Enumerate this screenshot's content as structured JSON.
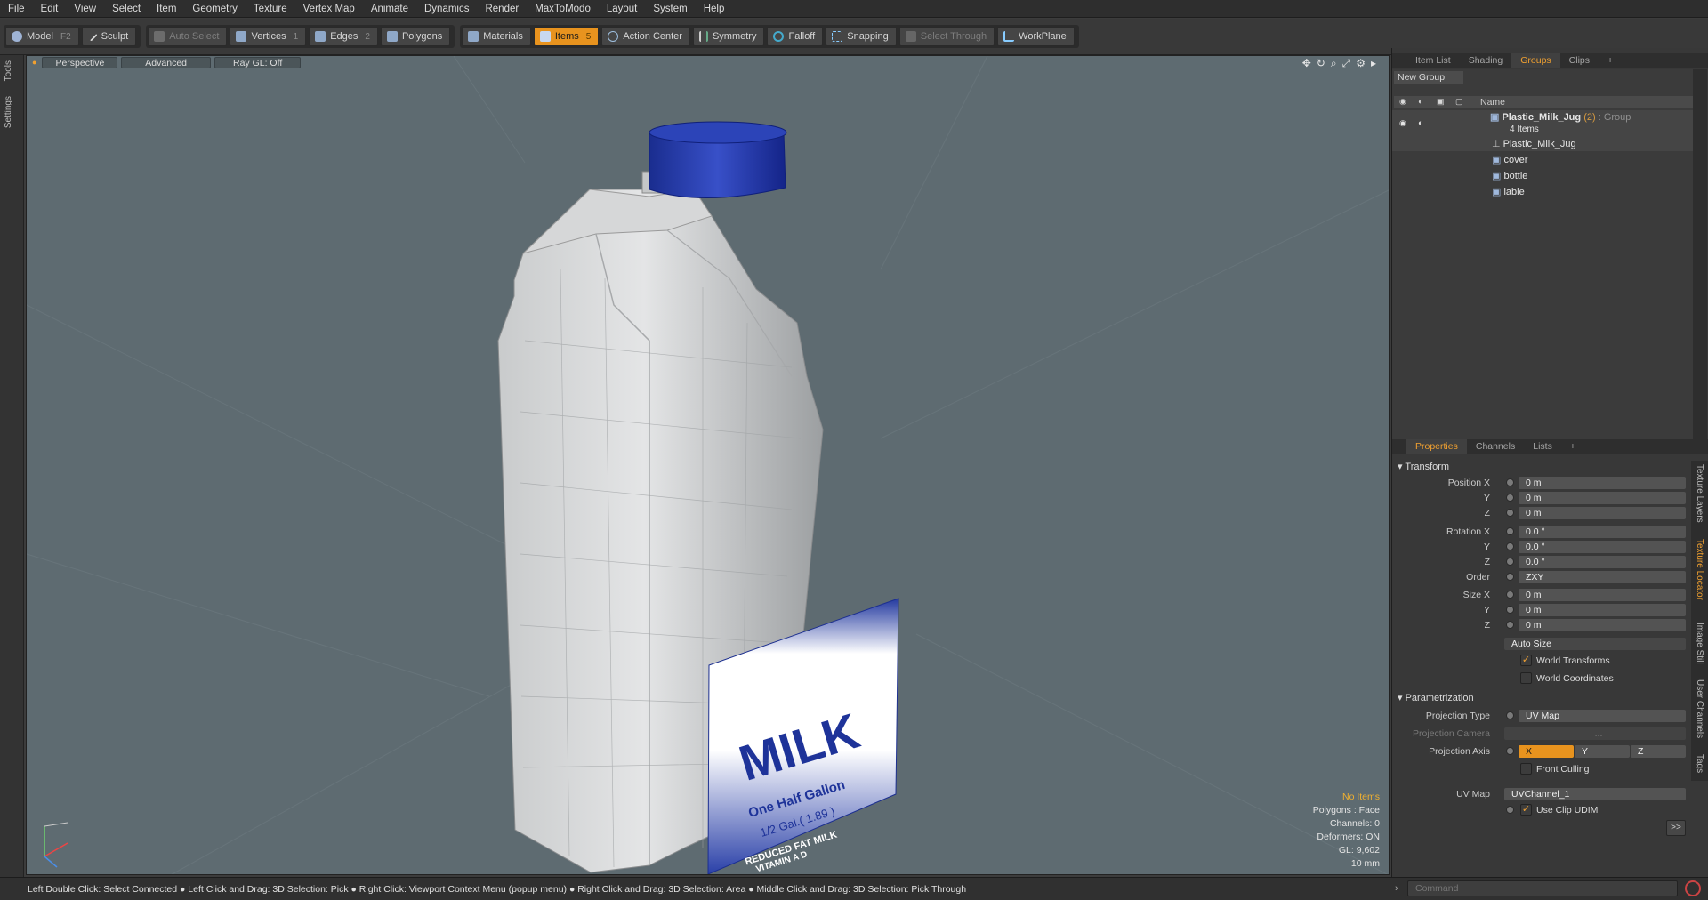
{
  "menu": [
    "File",
    "Edit",
    "View",
    "Select",
    "Item",
    "Geometry",
    "Texture",
    "Vertex Map",
    "Animate",
    "Dynamics",
    "Render",
    "MaxToModo",
    "Layout",
    "System",
    "Help"
  ],
  "toolbar": {
    "model": "Model",
    "model_key": "F2",
    "sculpt": "Sculpt",
    "auto_select": "Auto Select",
    "vertices": "Vertices",
    "vertices_key": "1",
    "edges": "Edges",
    "edges_key": "2",
    "polygons": "Polygons",
    "materials": "Materials",
    "items": "Items",
    "items_key": "5",
    "action_center": "Action Center",
    "symmetry": "Symmetry",
    "falloff": "Falloff",
    "snapping": "Snapping",
    "select_through": "Select Through",
    "workplane": "WorkPlane"
  },
  "left_tabs": [
    "Tools",
    "Settings"
  ],
  "viewport": {
    "perspective": "Perspective",
    "advanced": "Advanced",
    "raygl": "Ray GL: Off",
    "label": {
      "title": "MILK",
      "line1": "One Half Gallon",
      "line2": "1/2 Gal.( 1.89 )",
      "line3": "REDUCED FAT MILK",
      "line4": "VITAMIN A D"
    },
    "info": [
      "No Items",
      "Polygons : Face",
      "Channels: 0",
      "Deformers: ON",
      "GL: 9,602",
      "10 mm"
    ]
  },
  "status_text": "Left Double Click: Select Connected ● Left Click and Drag: 3D Selection: Pick ● Right Click: Viewport Context Menu (popup menu) ● Right Click and Drag: 3D Selection: Area ● Middle Click and Drag: 3D Selection: Pick Through",
  "command_placeholder": "Command",
  "top_tabs": [
    "Item List",
    "Shading",
    "Groups",
    "Clips"
  ],
  "groups": {
    "new_group": "New Group",
    "name_col": "Name",
    "root": {
      "name": "Plastic_Milk_Jug",
      "count": "(2)",
      "kind": ": Group",
      "items": "4 Items"
    },
    "children": [
      "Plastic_Milk_Jug",
      "cover",
      "bottle",
      "lable"
    ]
  },
  "bottom_tabs": [
    "Properties",
    "Channels",
    "Lists"
  ],
  "props": {
    "transform": "Transform",
    "pos_x_label": "Position X",
    "y_label": "Y",
    "z_label": "Z",
    "pos": [
      "0 m",
      "0 m",
      "0 m"
    ],
    "rot_x_label": "Rotation X",
    "rot": [
      "0.0 °",
      "0.0 °",
      "0.0 °"
    ],
    "order_label": "Order",
    "order": "ZXY",
    "size_x_label": "Size X",
    "size": [
      "0 m",
      "0 m",
      "0 m"
    ],
    "auto_size": "Auto Size",
    "world_transforms": "World Transforms",
    "world_coordinates": "World Coordinates",
    "parametrization": "Parametrization",
    "proj_type_label": "Projection Type",
    "proj_type": "UV Map",
    "proj_camera_label": "Projection Camera",
    "proj_camera": "...",
    "proj_axis_label": "Projection Axis",
    "axis_x": "X",
    "axis_y": "Y",
    "axis_z": "Z",
    "front_culling": "Front Culling",
    "uvmap_label": "UV Map",
    "uvmap": "UVChannel_1",
    "use_clip_udim": "Use Clip UDIM",
    "more": ">>"
  },
  "right_vtabs": [
    "Texture Layers",
    "Texture Locator",
    "Image Still",
    "User Channels",
    "Tags"
  ],
  "colors": {
    "accent": "#e8931e",
    "viewport_bg": "#5e6b71",
    "cap": "#1f36a8"
  }
}
